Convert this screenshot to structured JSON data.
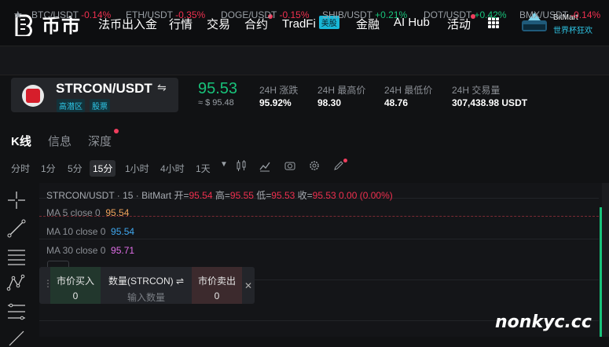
{
  "brand": {
    "name": "币市"
  },
  "nav": {
    "items": [
      "法币出入金",
      "行情",
      "交易",
      "合约",
      "TradFi",
      "金融",
      "AI Hub",
      "活动"
    ],
    "tradfi_tag": "美股",
    "promo_title": "BitMart",
    "promo_sub": "世界杯狂欢"
  },
  "ticker": [
    {
      "pair": "BTC/USDT",
      "change": "-0.14%",
      "dir": "down"
    },
    {
      "pair": "ETH/USDT",
      "change": "-0.35%",
      "dir": "down"
    },
    {
      "pair": "DOGE/USDT",
      "change": "-0.15%",
      "dir": "down"
    },
    {
      "pair": "SHIB/USDT",
      "change": "+0.21%",
      "dir": "up"
    },
    {
      "pair": "DOT/USDT",
      "change": "+0.42%",
      "dir": "up"
    },
    {
      "pair": "BMX/USDT",
      "change": "-0.14%",
      "dir": "down"
    }
  ],
  "pair": {
    "name": "STRCON/USDT",
    "badge1": "高潜区",
    "badge2": "股票",
    "price": "95.53",
    "price_usd": "≈ $ 95.48"
  },
  "stats": [
    {
      "label": "24H 涨跌",
      "value": "95.92%"
    },
    {
      "label": "24H 最高价",
      "value": "98.30"
    },
    {
      "label": "24H 最低价",
      "value": "48.76"
    },
    {
      "label": "24H 交易量",
      "value": "307,438.98 USDT"
    }
  ],
  "tabs": [
    "K线",
    "信息",
    "深度"
  ],
  "intervals": [
    "分时",
    "1分",
    "5分",
    "15分",
    "1小时",
    "4小时",
    "1天"
  ],
  "chart": {
    "title_prefix": "STRCON/USDT · 15 · BitMart",
    "open_label": "开=",
    "open": "95.54",
    "high_label": "高=",
    "high": "95.55",
    "low_label": "低=",
    "low": "95.53",
    "close_label": "收=",
    "close": "95.53",
    "change": "0.00 (0.00%)",
    "ma": [
      {
        "label": "MA 5 close 0",
        "value": "95.54",
        "color": "#f0a45c"
      },
      {
        "label": "MA 10 close 0",
        "value": "95.54",
        "color": "#3fa8f0"
      },
      {
        "label": "MA 30 close 0",
        "value": "95.71",
        "color": "#e06ee8"
      }
    ]
  },
  "order": {
    "buy_label": "市价买入",
    "buy_value": "0",
    "qty_label": "数量(STRCON)",
    "qty_placeholder": "输入数量",
    "sell_label": "市价卖出",
    "sell_value": "0"
  },
  "watermark": "nonkyc.cc"
}
